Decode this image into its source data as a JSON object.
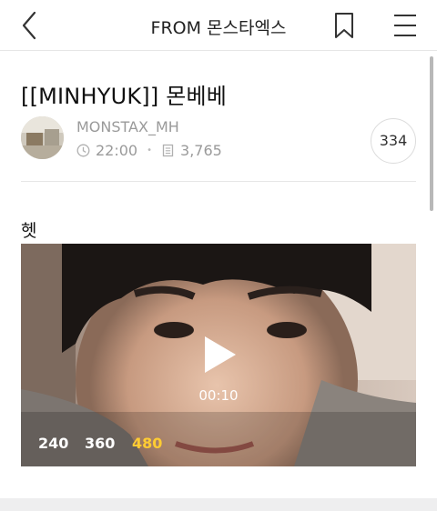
{
  "header": {
    "title": "FROM 몬스타엑스",
    "back_icon": "chevron-left-icon",
    "bookmark_icon": "bookmark-icon",
    "menu_icon": "hamburger-menu-icon"
  },
  "post": {
    "title": "[[MINHYUK]] 몬베베",
    "author": "MONSTAX_MH",
    "time": "22:00",
    "views": "3,765",
    "comment_count": "334",
    "caption": "헷"
  },
  "video": {
    "duration": "00:10",
    "qualities": [
      "240",
      "360",
      "480"
    ],
    "selected_quality": "480"
  },
  "colors": {
    "selected_quality": "#ffcc33",
    "meta_text": "#9a9a9a"
  }
}
